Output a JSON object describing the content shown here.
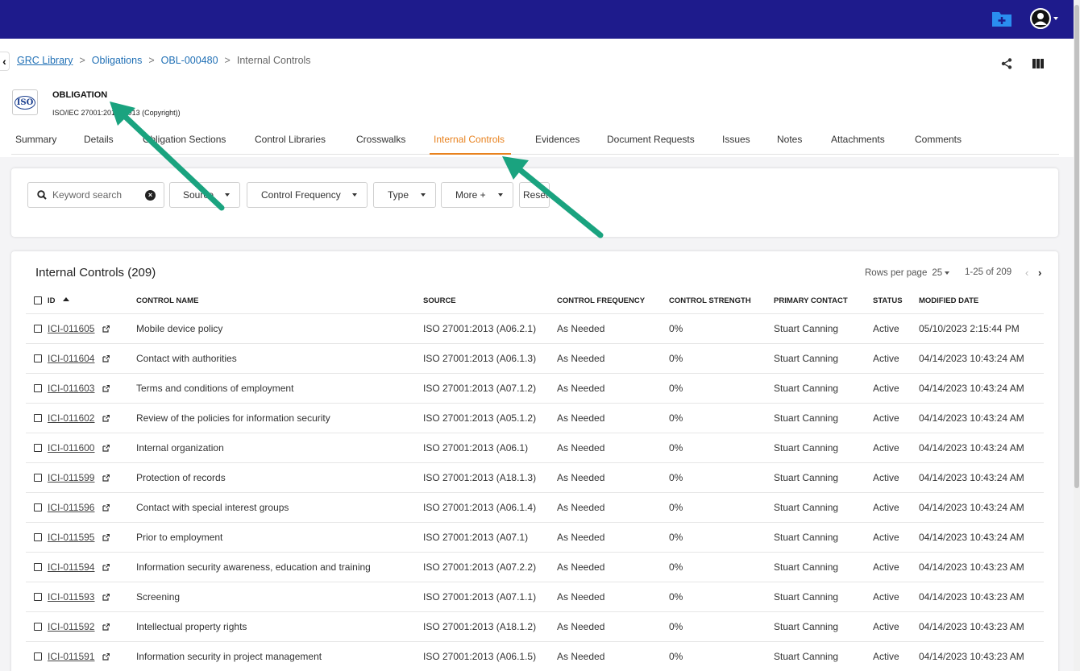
{
  "breadcrumb": {
    "items": [
      "GRC Library",
      "Obligations",
      "OBL-000480",
      "Internal Controls"
    ],
    "separator": ">"
  },
  "obligation": {
    "label": "OBLIGATION",
    "subtitle": "ISO/IEC 27001:2013 (2013 (Copyright))",
    "logo_text": "ISO"
  },
  "tabs": [
    {
      "label": "Summary",
      "active": false
    },
    {
      "label": "Details",
      "active": false
    },
    {
      "label": "Obligation Sections",
      "active": false
    },
    {
      "label": "Control Libraries",
      "active": false
    },
    {
      "label": "Crosswalks",
      "active": false
    },
    {
      "label": "Internal Controls",
      "active": true
    },
    {
      "label": "Evidences",
      "active": false
    },
    {
      "label": "Document Requests",
      "active": false
    },
    {
      "label": "Issues",
      "active": false
    },
    {
      "label": "Notes",
      "active": false
    },
    {
      "label": "Attachments",
      "active": false
    },
    {
      "label": "Comments",
      "active": false
    }
  ],
  "filters": {
    "search_placeholder": "Keyword search",
    "source": "Source",
    "control_frequency": "Control Frequency",
    "type": "Type",
    "more": "More +",
    "reset": "Reset"
  },
  "table": {
    "title": "Internal Controls (209)",
    "rows_per_page_label": "Rows per page",
    "rows_per_page_value": "25",
    "range": "1-25 of 209",
    "columns": [
      "ID",
      "CONTROL NAME",
      "SOURCE",
      "CONTROL FREQUENCY",
      "CONTROL STRENGTH",
      "PRIMARY CONTACT",
      "STATUS",
      "MODIFIED DATE"
    ],
    "rows": [
      {
        "id": "ICI-011605",
        "name": "Mobile device policy",
        "source": "ISO 27001:2013 (A06.2.1)",
        "freq": "As Needed",
        "strength": "0%",
        "contact": "Stuart Canning",
        "status": "Active",
        "date": "05/10/2023 2:15:44 PM"
      },
      {
        "id": "ICI-011604",
        "name": "Contact with authorities",
        "source": "ISO 27001:2013 (A06.1.3)",
        "freq": "As Needed",
        "strength": "0%",
        "contact": "Stuart Canning",
        "status": "Active",
        "date": "04/14/2023 10:43:24 AM"
      },
      {
        "id": "ICI-011603",
        "name": "Terms and conditions of employment",
        "source": "ISO 27001:2013 (A07.1.2)",
        "freq": "As Needed",
        "strength": "0%",
        "contact": "Stuart Canning",
        "status": "Active",
        "date": "04/14/2023 10:43:24 AM"
      },
      {
        "id": "ICI-011602",
        "name": "Review of the policies for information security",
        "source": "ISO 27001:2013 (A05.1.2)",
        "freq": "As Needed",
        "strength": "0%",
        "contact": "Stuart Canning",
        "status": "Active",
        "date": "04/14/2023 10:43:24 AM"
      },
      {
        "id": "ICI-011600",
        "name": "Internal organization",
        "source": "ISO 27001:2013 (A06.1)",
        "freq": "As Needed",
        "strength": "0%",
        "contact": "Stuart Canning",
        "status": "Active",
        "date": "04/14/2023 10:43:24 AM"
      },
      {
        "id": "ICI-011599",
        "name": "Protection of records",
        "source": "ISO 27001:2013 (A18.1.3)",
        "freq": "As Needed",
        "strength": "0%",
        "contact": "Stuart Canning",
        "status": "Active",
        "date": "04/14/2023 10:43:24 AM"
      },
      {
        "id": "ICI-011596",
        "name": "Contact with special interest groups",
        "source": "ISO 27001:2013 (A06.1.4)",
        "freq": "As Needed",
        "strength": "0%",
        "contact": "Stuart Canning",
        "status": "Active",
        "date": "04/14/2023 10:43:24 AM"
      },
      {
        "id": "ICI-011595",
        "name": "Prior to employment",
        "source": "ISO 27001:2013 (A07.1)",
        "freq": "As Needed",
        "strength": "0%",
        "contact": "Stuart Canning",
        "status": "Active",
        "date": "04/14/2023 10:43:24 AM"
      },
      {
        "id": "ICI-011594",
        "name": "Information security awareness, education and training",
        "source": "ISO 27001:2013 (A07.2.2)",
        "freq": "As Needed",
        "strength": "0%",
        "contact": "Stuart Canning",
        "status": "Active",
        "date": "04/14/2023 10:43:23 AM"
      },
      {
        "id": "ICI-011593",
        "name": "Screening",
        "source": "ISO 27001:2013 (A07.1.1)",
        "freq": "As Needed",
        "strength": "0%",
        "contact": "Stuart Canning",
        "status": "Active",
        "date": "04/14/2023 10:43:23 AM"
      },
      {
        "id": "ICI-011592",
        "name": "Intellectual property rights",
        "source": "ISO 27001:2013 (A18.1.2)",
        "freq": "As Needed",
        "strength": "0%",
        "contact": "Stuart Canning",
        "status": "Active",
        "date": "04/14/2023 10:43:23 AM"
      },
      {
        "id": "ICI-011591",
        "name": "Information security in project management",
        "source": "ISO 27001:2013 (A06.1.5)",
        "freq": "As Needed",
        "strength": "0%",
        "contact": "Stuart Canning",
        "status": "Active",
        "date": "04/14/2023 10:43:23 AM"
      }
    ]
  },
  "icons": {
    "folder": "folder-plus-icon",
    "avatar": "user-avatar-icon",
    "share": "share-icon",
    "columns": "columns-icon",
    "external": "external-link-icon"
  },
  "colors": {
    "topbar": "#1e1b8c",
    "link": "#1f6fb5",
    "active_tab": "#e8821f",
    "folder_icon": "#2a8ef0",
    "annotation_arrow": "#1aa37f"
  }
}
